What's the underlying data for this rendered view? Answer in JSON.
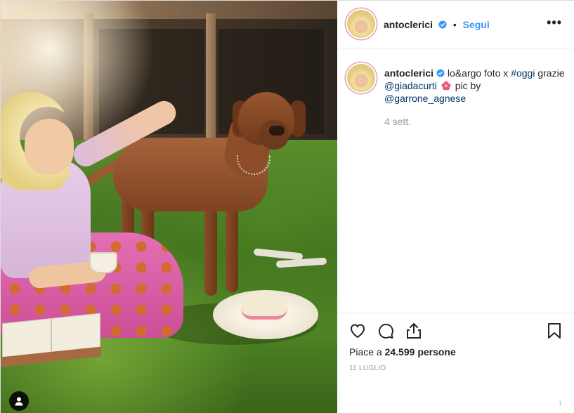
{
  "post": {
    "username": "antoclerici",
    "follow_label": "Segui",
    "dot_separator": "•",
    "more_label": "•••"
  },
  "caption": {
    "username": "antoclerici",
    "text_part1": "lo&argo foto x",
    "hashtag": "#oggi",
    "text_part2": "grazie",
    "mention1": "@giadacurti",
    "text_part3": "pic by",
    "mention2": "@garrone_agnese",
    "time_ago": "4 sett."
  },
  "actions": {
    "likes_prefix": "Piace a",
    "likes_count": "24.599",
    "likes_suffix": "persone",
    "date": "11 LUGLIO"
  },
  "footer": {
    "indicator": "1"
  },
  "icons": [
    "verified-badge-icon",
    "heart-icon",
    "comment-icon",
    "share-icon",
    "bookmark-icon",
    "user-tag-icon",
    "flower-emoji-icon"
  ],
  "colors": {
    "follow_blue": "#3897f0",
    "link_blue": "#003569",
    "verified_blue": "#3897f0",
    "muted_gray": "#999999"
  }
}
